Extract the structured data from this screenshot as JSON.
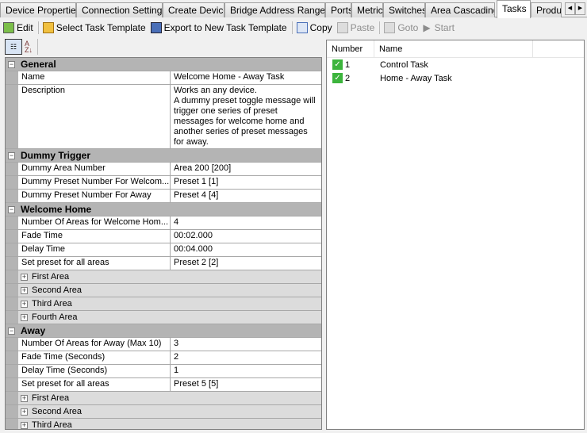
{
  "tabs": [
    "Device Properties",
    "Connection Settings",
    "Create Device",
    "Bridge Address Ranges",
    "Ports",
    "Metrics",
    "Switches",
    "Area Cascading",
    "Tasks",
    "Produc"
  ],
  "active_tab": "Tasks",
  "toolbar": {
    "edit": "Edit",
    "select_template": "Select Task Template",
    "export_template": "Export to New Task Template",
    "copy": "Copy",
    "paste": "Paste",
    "goto": "Goto",
    "start": "Start"
  },
  "grid": [
    {
      "type": "cat",
      "label": "General"
    },
    {
      "type": "prop",
      "label": "Name",
      "value": "Welcome Home - Away Task"
    },
    {
      "type": "prop",
      "label": "Description",
      "value": "Works an any device.\nA dummy preset toggle message will trigger one series of preset messages for welcome home and another series of preset messages for away."
    },
    {
      "type": "cat",
      "label": "Dummy Trigger"
    },
    {
      "type": "prop",
      "label": "Dummy Area Number",
      "value": "Area 200 [200]"
    },
    {
      "type": "prop",
      "label": "Dummy Preset Number For Welcom...",
      "value": "Preset 1 [1]"
    },
    {
      "type": "prop",
      "label": "Dummy Preset Number For Away",
      "value": "Preset 4 [4]"
    },
    {
      "type": "cat",
      "label": "Welcome Home"
    },
    {
      "type": "prop",
      "label": "Number Of Areas for Welcome Hom...",
      "value": "4"
    },
    {
      "type": "prop",
      "label": "Fade Time",
      "value": "00:02.000"
    },
    {
      "type": "prop",
      "label": "Delay Time",
      "value": "00:04.000"
    },
    {
      "type": "prop",
      "label": "Set preset for all areas",
      "value": "Preset 2 [2]"
    },
    {
      "type": "sub",
      "label": "First Area"
    },
    {
      "type": "sub",
      "label": "Second Area"
    },
    {
      "type": "sub",
      "label": "Third Area"
    },
    {
      "type": "sub",
      "label": "Fourth Area"
    },
    {
      "type": "cat",
      "label": "Away"
    },
    {
      "type": "prop",
      "label": "Number Of Areas for Away (Max 10)",
      "value": "3"
    },
    {
      "type": "prop",
      "label": "Fade Time (Seconds)",
      "value": "2"
    },
    {
      "type": "prop",
      "label": "Delay Time (Seconds)",
      "value": "1"
    },
    {
      "type": "prop",
      "label": "Set preset for all areas",
      "value": "Preset 5 [5]"
    },
    {
      "type": "sub",
      "label": "First Area"
    },
    {
      "type": "sub",
      "label": "Second Area"
    },
    {
      "type": "sub",
      "label": "Third Area"
    }
  ],
  "list": {
    "headers": [
      "Number",
      "Name"
    ],
    "items": [
      {
        "number": "1",
        "name": "Control Task"
      },
      {
        "number": "2",
        "name": "Home - Away Task"
      }
    ]
  }
}
